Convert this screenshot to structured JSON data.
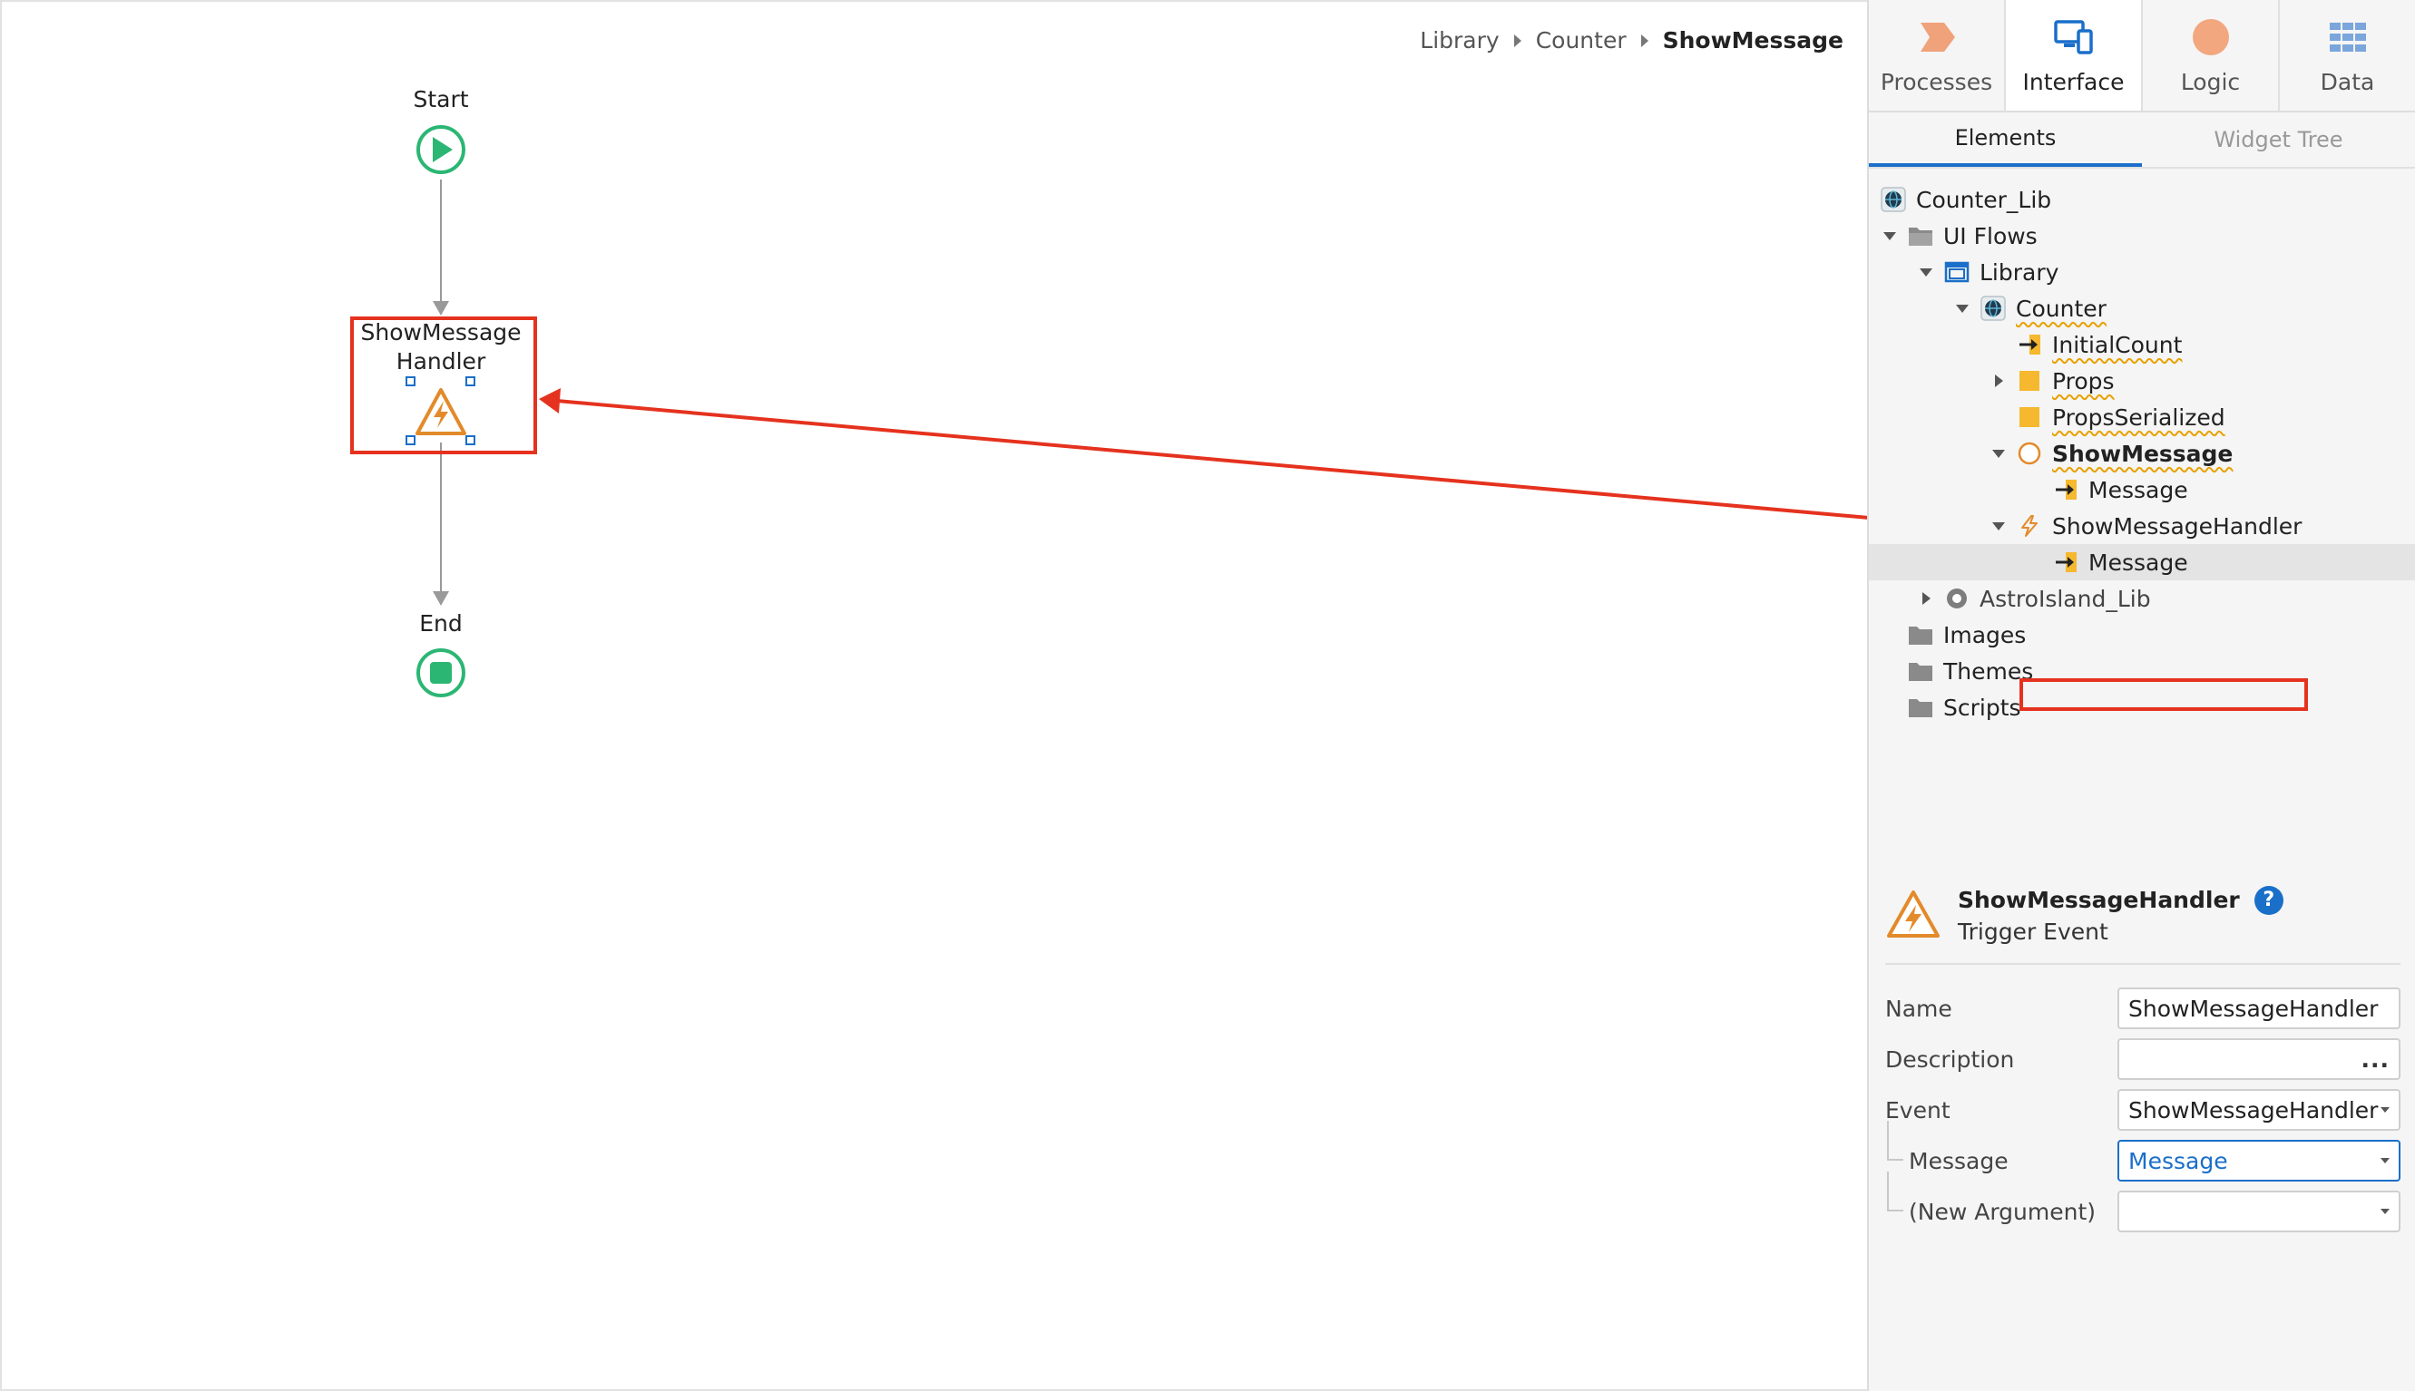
{
  "breadcrumb": {
    "items": [
      "Library",
      "Counter"
    ],
    "current": "ShowMessage"
  },
  "flow": {
    "start_label": "Start",
    "handler_label_line1": "ShowMessage",
    "handler_label_line2": "Handler",
    "end_label": "End"
  },
  "colors": {
    "accent_blue": "#1a6fc9",
    "highlight_red": "#e5321e",
    "flow_green": "#2bb673",
    "trigger_orange": "#e38a2a",
    "warning_yellow": "#f5b82e"
  },
  "top_tabs": [
    {
      "label": "Processes",
      "icon": "processes-chevron-icon"
    },
    {
      "label": "Interface",
      "icon": "interface-devices-icon",
      "active": true
    },
    {
      "label": "Logic",
      "icon": "logic-circle-icon"
    },
    {
      "label": "Data",
      "icon": "data-grid-icon"
    }
  ],
  "sub_tabs": [
    {
      "label": "Elements",
      "active": true
    },
    {
      "label": "Widget Tree"
    }
  ],
  "tree": [
    {
      "label": "Counter_Lib",
      "icon": "library-globe-icon",
      "level": 0
    },
    {
      "label": "UI Flows",
      "icon": "folder-open-icon",
      "level": 1,
      "expanded": true
    },
    {
      "label": "Library",
      "icon": "ui-flow-icon",
      "level": 2,
      "expanded": true
    },
    {
      "label": "Counter",
      "icon": "block-globe-icon",
      "level": 3,
      "expanded": true,
      "warn": true
    },
    {
      "label": "InitialCount",
      "icon": "input-parameter-icon",
      "level": 4,
      "warn": true
    },
    {
      "label": "Props",
      "icon": "structure-square-icon",
      "level": 4,
      "collapsed": true,
      "warn": true
    },
    {
      "label": "PropsSerialized",
      "icon": "structure-square-icon",
      "level": 4,
      "warn": true
    },
    {
      "label": "ShowMessage",
      "icon": "client-action-circle-icon",
      "level": 4,
      "expanded": true,
      "warn": true,
      "bold": true
    },
    {
      "label": "Message",
      "icon": "input-parameter-icon",
      "level": 5
    },
    {
      "label": "ShowMessageHandler",
      "icon": "trigger-event-icon",
      "level": 4,
      "expanded": true,
      "highlighted": true
    },
    {
      "label": "Message",
      "icon": "input-parameter-icon",
      "level": 5,
      "selected": true
    },
    {
      "label": "AstroIsland_Lib",
      "icon": "dependency-circle-icon",
      "level": 2,
      "collapsed": true,
      "muted": true
    },
    {
      "label": "Images",
      "icon": "folder-icon",
      "level": 1
    },
    {
      "label": "Themes",
      "icon": "folder-icon",
      "level": 1
    },
    {
      "label": "Scripts",
      "icon": "folder-icon",
      "level": 1
    }
  ],
  "properties": {
    "title": "ShowMessageHandler",
    "subtitle": "Trigger Event",
    "help": "?",
    "rows": [
      {
        "label": "Name",
        "value": "ShowMessageHandler",
        "kind": "text"
      },
      {
        "label": "Description",
        "value": "",
        "kind": "ellipsis",
        "ellipsis": "..."
      },
      {
        "label": "Event",
        "value": "ShowMessageHandler",
        "kind": "dropdown"
      },
      {
        "label": "Message",
        "value": "Message",
        "kind": "dropdown",
        "child": true,
        "focused": true
      },
      {
        "label": "(New Argument)",
        "value": "",
        "kind": "dropdown",
        "child": true,
        "last": true
      }
    ]
  }
}
